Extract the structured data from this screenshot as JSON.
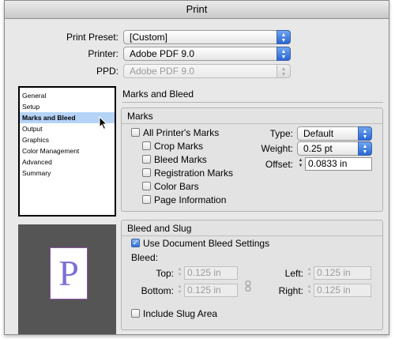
{
  "window": {
    "title": "Print"
  },
  "top": {
    "print_preset": {
      "label": "Print Preset:",
      "value": "[Custom]"
    },
    "printer": {
      "label": "Printer:",
      "value": "Adobe PDF 9.0"
    },
    "ppd": {
      "label": "PPD:",
      "value": "Adobe PDF 9.0"
    }
  },
  "sidebar": {
    "items": [
      {
        "label": "General"
      },
      {
        "label": "Setup"
      },
      {
        "label": "Marks and Bleed",
        "selected": true
      },
      {
        "label": "Output"
      },
      {
        "label": "Graphics"
      },
      {
        "label": "Color Management"
      },
      {
        "label": "Advanced"
      },
      {
        "label": "Summary"
      }
    ]
  },
  "preview": {
    "letter": "P"
  },
  "section": {
    "title": "Marks and Bleed"
  },
  "marks": {
    "title": "Marks",
    "all_printers_marks": {
      "label": "All Printer's Marks",
      "checked": false
    },
    "crop_marks": {
      "label": "Crop Marks",
      "checked": false
    },
    "bleed_marks": {
      "label": "Bleed Marks",
      "checked": false
    },
    "registration_marks": {
      "label": "Registration Marks",
      "checked": false
    },
    "color_bars": {
      "label": "Color Bars",
      "checked": false
    },
    "page_information": {
      "label": "Page Information",
      "checked": false
    },
    "type": {
      "label": "Type:",
      "value": "Default"
    },
    "weight": {
      "label": "Weight:",
      "value": "0.25 pt"
    },
    "offset": {
      "label": "Offset:",
      "value": "0.0833 in"
    }
  },
  "bleed_slug": {
    "title": "Bleed and Slug",
    "use_document_bleed": {
      "label": "Use Document Bleed Settings",
      "checked": true,
      "check_glyph": "✓"
    },
    "bleed_label": "Bleed:",
    "top": {
      "label": "Top:",
      "value": "0.125 in"
    },
    "bottom": {
      "label": "Bottom:",
      "value": "0.125 in"
    },
    "left": {
      "label": "Left:",
      "value": "0.125 in"
    },
    "right": {
      "label": "Right:",
      "value": "0.125 in"
    },
    "include_slug": {
      "label": "Include Slug Area",
      "checked": false
    }
  },
  "icons": {
    "popup_arrows": "▲▼",
    "stepper_arrows": "▲▼",
    "cursor": "arrow-cursor-icon",
    "chain": "chain-link-icon"
  }
}
